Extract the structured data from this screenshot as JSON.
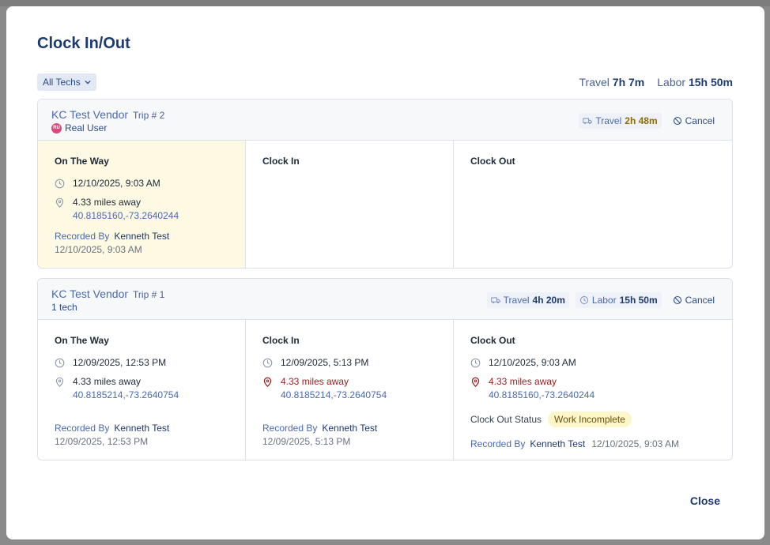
{
  "modal": {
    "title": "Clock In/Out",
    "filter_label": "All Techs",
    "totals": {
      "travel_label": "Travel",
      "travel_value": "7h 7m",
      "labor_label": "Labor",
      "labor_value": "15h 50m"
    },
    "close_label": "Close"
  },
  "trips": [
    {
      "vendor": "KC Test Vendor",
      "trip": "Trip # 2",
      "sub_badge": "RU",
      "sub": "Real User",
      "travel_label": "Travel",
      "travel_value": "2h 48m",
      "cancel_label": "Cancel",
      "on_the_way": {
        "title": "On The Way",
        "time": "12/10/2025, 9:03 AM",
        "distance": "4.33 miles away",
        "coords": "40.8185160,-73.2640244",
        "recorded_label": "Recorded By",
        "recorded_by": "Kenneth Test",
        "recorded_at": "12/10/2025, 9:03 AM"
      },
      "clock_in": {
        "title": "Clock In"
      },
      "clock_out": {
        "title": "Clock Out"
      }
    },
    {
      "vendor": "KC Test Vendor",
      "trip": "Trip # 1",
      "sub": "1 tech",
      "travel_label": "Travel",
      "travel_value": "4h 20m",
      "labor_label": "Labor",
      "labor_value": "15h 50m",
      "cancel_label": "Cancel",
      "on_the_way": {
        "title": "On The Way",
        "time": "12/09/2025, 12:53 PM",
        "distance": "4.33 miles away",
        "coords": "40.8185214,-73.2640754",
        "recorded_label": "Recorded By",
        "recorded_by": "Kenneth Test",
        "recorded_at": "12/09/2025, 12:53 PM"
      },
      "clock_in": {
        "title": "Clock In",
        "time": "12/09/2025, 5:13 PM",
        "distance": "4.33 miles away",
        "coords": "40.8185214,-73.2640754",
        "recorded_label": "Recorded By",
        "recorded_by": "Kenneth Test",
        "recorded_at": "12/09/2025, 5:13 PM"
      },
      "clock_out": {
        "title": "Clock Out",
        "time": "12/10/2025, 9:03 AM",
        "distance": "4.33 miles away",
        "coords": "40.8185160,-73.2640244",
        "status_label": "Clock Out Status",
        "status": "Work Incomplete",
        "recorded_label": "Recorded By",
        "recorded_by": "Kenneth Test",
        "recorded_at": "12/10/2025, 9:03 AM"
      }
    }
  ]
}
